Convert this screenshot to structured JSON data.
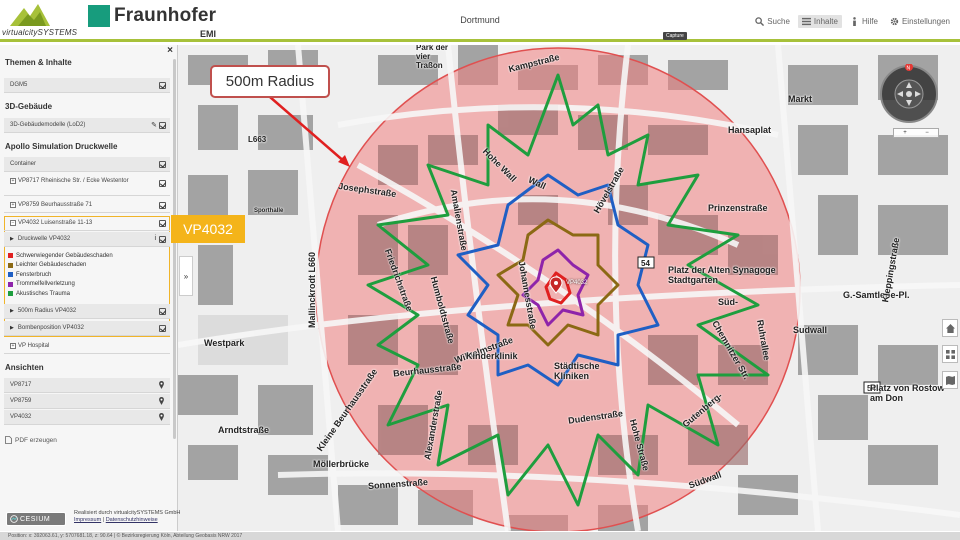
{
  "header": {
    "vcs_logo_text": "virtualcitySYSTEMS",
    "fraunhofer_name": "Fraunhofer",
    "fraunhofer_sub": "EMI",
    "city": "Dortmund",
    "nav": [
      {
        "label": "Suche",
        "icon": "search-icon"
      },
      {
        "label": "Inhalte",
        "icon": "list-icon",
        "active": true
      },
      {
        "label": "Hilfe",
        "icon": "info-icon"
      },
      {
        "label": "Einstellungen",
        "icon": "gear-icon"
      }
    ],
    "capture_tooltip": "Capture"
  },
  "sidebar": {
    "close": "×",
    "themes_title": "Themen & Inhalte",
    "dgm": "DGM5",
    "buildings_title": "3D-Gebäude",
    "buildings_row": "3D-Gebäudemodelle (LoD2)",
    "apollo_title": "Apollo Simulation Druckwelle",
    "container": "Container",
    "vp8717": "VP8717 Rheinische Str. / Ecke Westentor",
    "vp8759": "VP8759 Beurhausstraße 71",
    "vp4032": "VP4032 Luisenstraße 11-13",
    "druckwelle": "Druckwelle VP4032",
    "druckwelle_extra": "i",
    "legend": [
      {
        "label": "Schwerwiegender Gebäudeschaden",
        "color": "#e02020"
      },
      {
        "label": "Leichter Gebäudeschaden",
        "color": "#8b6914"
      },
      {
        "label": "Fensterbruch",
        "color": "#1f5fc4"
      },
      {
        "label": "Trommelfellverletzung",
        "color": "#8e24aa"
      },
      {
        "label": "Akustisches Trauma",
        "color": "#1e9e3e"
      }
    ],
    "radius_row": "500m Radius VP4032",
    "bomb_row": "Bombenposition VP4032",
    "vp_hospital": "VP Hospital",
    "views_title": "Ansichten",
    "views": [
      "VP8717",
      "VP8759",
      "VP4032"
    ],
    "pdf": "PDF erzeugen",
    "collapse": "»"
  },
  "badge": "VP4032",
  "callout": "500m Radius",
  "marker_label": "VP4032",
  "map_labels": [
    "Kampstraße",
    "Park der vier Traßon",
    "Markt",
    "Hansaplat",
    "L663",
    "Josephstraße",
    "Hohe Wall",
    "Wall",
    "Hövelstraße",
    "Prinzenstraße",
    "Platz der Alten Synagoge Stadtgarten",
    "Süd-",
    "G.-Samtlebe-Pl.",
    "Westpark",
    "Mallinckrodt L660",
    "Friedrichstraße",
    "Amalienstraße",
    "Johannesstraße",
    "Humboldtstraße",
    "Wilhelmstraße",
    "Kinderklinik",
    "Städtische Kliniken",
    "Beurhausstraße",
    "Sudwall",
    "Dudenstraße",
    "Hohe Straße",
    "Chemnitzer Str.",
    "Ruhrallee",
    "Gutenberg-",
    "Südwall",
    "Kleine Beurhausstraße",
    "Alexanderstraße",
    "Arndtstraße",
    "Möllerbrücke",
    "Sonnenstraße",
    "Platz von Rostow am Don",
    "Sporthalle",
    "Kleppingstraße"
  ],
  "footer": {
    "cesium": "CESIUM",
    "credit1": "Realisiert durch virtualcitySYSTEMS GmbH",
    "imprint": "Impressum",
    "privacy": "Datenschutzhinweise",
    "status": "Position: x: 392063.61, y: 5707681.18, z: 90.64 | © Bezirksregierung Köln, Abteilung Geobasis NRW 2017"
  },
  "colors": {
    "accent": "#a7c13a",
    "badge": "#f4b41a",
    "radius_fill": "#f08080",
    "radius_stroke": "#e05050",
    "callout_border": "#c0504d",
    "fraunhofer_green": "#179c7d"
  }
}
